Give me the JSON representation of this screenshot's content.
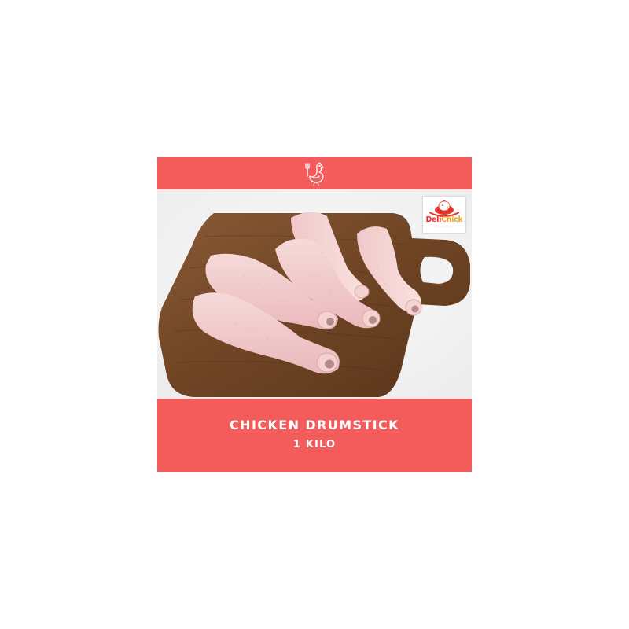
{
  "card": {
    "icon": "chicken-with-fork-icon",
    "product_name": "CHICKEN DRUMSTICK",
    "quantity": "1 KILO",
    "band_color": "#f45b5b",
    "text_color": "#ffffff"
  },
  "logo": {
    "brand_part1": "Deli",
    "brand_part2": "Chick"
  }
}
